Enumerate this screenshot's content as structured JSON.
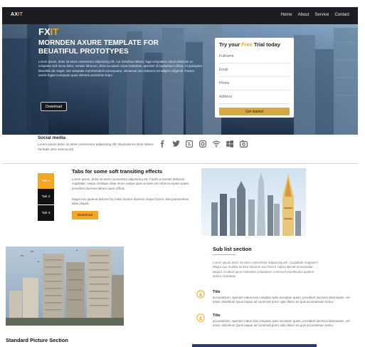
{
  "brand": {
    "prefix": "AX",
    "accent": "IT",
    "accent_color": "#f5a623"
  },
  "nav": {
    "items": [
      "Home",
      "About",
      "Service",
      "Contact"
    ]
  },
  "hero": {
    "logo_prefix": "FX",
    "logo_accent": "IT",
    "title": "MORNDEN AXURE TEMPLATE FOR BEUATIFUL PROTOTYPES",
    "body": "Lorem ipsum, dolor sit amet consectetur adipisicing elit. Aut doloribus labore, fuga voluptates minus distinctio ex voluptate sed nemo dolor, veniam laborum, dicta excepturi culpa molestiae, aperiam id laudantium officia. At quisquam blanditiis ab magni, sint voluptate reprehenderit consequatur, obcaecati iure dolorem vel adipisci eligendi. Facere omnis fugiat numquam quas dolorem possimus sequi.",
    "button": "Download"
  },
  "trial": {
    "title_prefix": "Try your ",
    "title_accent": "Free",
    "title_suffix": " Trial today",
    "fields": [
      {
        "placeholder": "Fullname"
      },
      {
        "placeholder": "Email"
      },
      {
        "placeholder": "Phone"
      },
      {
        "placeholder": "Address"
      }
    ],
    "button": "Get started"
  },
  "social": {
    "title": "Social media",
    "text": "Lorem ipsum dolor sit amet consectetur adipisicing elit. Dignissimos dicta labore Veritatis vero minima dol.",
    "icons": [
      "facebook-icon",
      "twitter-icon",
      "blogger-icon",
      "instagram-icon",
      "wifi-icon",
      "windows-icon",
      "camera-icon"
    ]
  },
  "tabs": {
    "items": [
      "Tab 1",
      "Tab 2",
      "Tab 3"
    ],
    "active_index": 0,
    "heading": "Tabs for some soft transiting effects",
    "p1": "Lorem ipsum, dolor sit amet consectetur adipisicing elit. Facilis a eveniet delectus cupiditate, eaque similique vitae rerum saepe quas veniam vel nobis excepturi quam, provident ducimus labore quasi officia.",
    "p2": "Magni eos quaerat dolores hic nobis tenetur dolorem neque facere odio praesentium alias aliquid.",
    "button": "Download"
  },
  "sub_list": {
    "title": "Sub list section",
    "intro": "Lorem ipsum dolor sit amet consectetur adipisicing elit. Cupiditate magnam? Magni quo mollitia tenetur dolorem iure facere culpa placeat recusandae aliquid, incidunt quos molestiae voluptatum commodi repellendus quidem dolore molestias.",
    "items": [
      {
        "title": "Title",
        "text": "accusantium, aperiam natus eius voluptas optio excepturi quam, provident ducimus laboriosam, vel amet, doloribus! Quos eaque ad commodi porro optio libero ex quis accusantium nemo."
      },
      {
        "title": "Title",
        "text": "accusantium, aperiam natus eius voluptas optio excepturi quam, provident ducimus laboriosam, vel amet, doloribus! Quos eaque ad commodi porro optio libero ex quis accusantium nemo."
      }
    ]
  },
  "standard_picture": {
    "title": "Standard Picture Section"
  }
}
